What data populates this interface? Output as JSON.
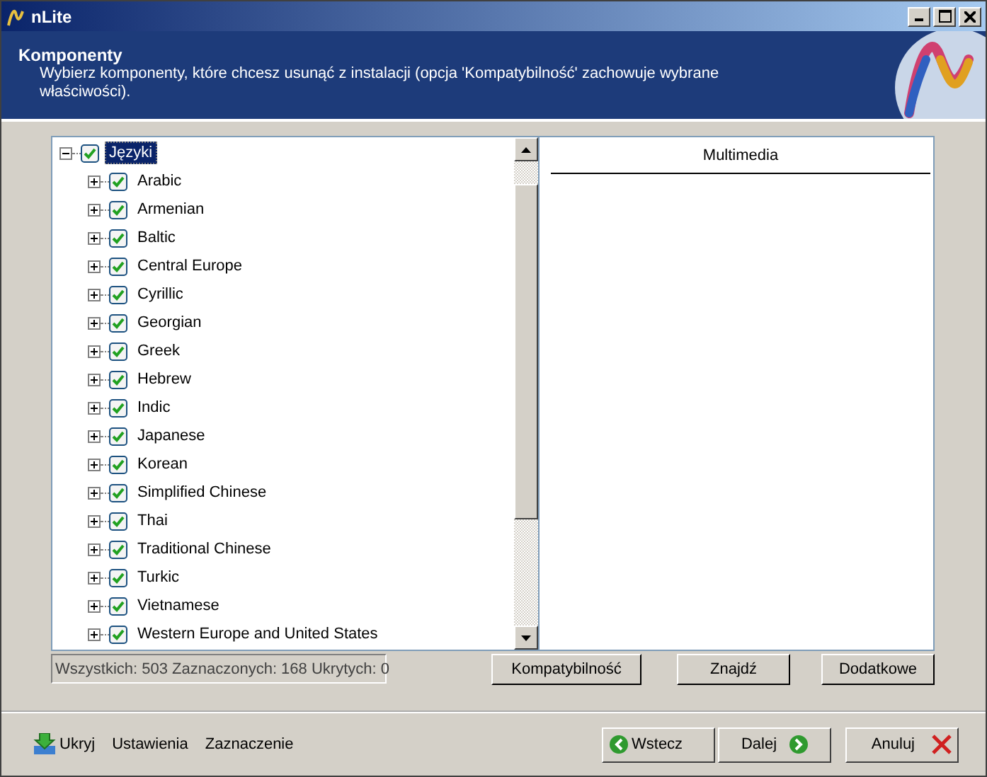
{
  "window": {
    "title": "nLite"
  },
  "header": {
    "title": "Komponenty",
    "description": "Wybierz komponenty, które chcesz usunąć z instalacji (opcja 'Kompatybilność' zachowuje wybrane właściwości)."
  },
  "tree": [
    {
      "label": "Języki",
      "checked": true,
      "expanded": true,
      "selected": true,
      "children": [
        {
          "label": "Arabic",
          "checked": true,
          "expanded": false,
          "selected": false
        },
        {
          "label": "Armenian",
          "checked": true,
          "expanded": false,
          "selected": false
        },
        {
          "label": "Baltic",
          "checked": true,
          "expanded": false,
          "selected": false
        },
        {
          "label": "Central Europe",
          "checked": true,
          "expanded": false,
          "selected": false
        },
        {
          "label": "Cyrillic",
          "checked": true,
          "expanded": false,
          "selected": false
        },
        {
          "label": "Georgian",
          "checked": true,
          "expanded": false,
          "selected": false
        },
        {
          "label": "Greek",
          "checked": true,
          "expanded": false,
          "selected": false
        },
        {
          "label": "Hebrew",
          "checked": true,
          "expanded": false,
          "selected": false
        },
        {
          "label": "Indic",
          "checked": true,
          "expanded": false,
          "selected": false
        },
        {
          "label": "Japanese",
          "checked": true,
          "expanded": false,
          "selected": false
        },
        {
          "label": "Korean",
          "checked": true,
          "expanded": false,
          "selected": false
        },
        {
          "label": "Simplified Chinese",
          "checked": true,
          "expanded": false,
          "selected": false
        },
        {
          "label": "Thai",
          "checked": true,
          "expanded": false,
          "selected": false
        },
        {
          "label": "Traditional Chinese",
          "checked": true,
          "expanded": false,
          "selected": false
        },
        {
          "label": "Turkic",
          "checked": true,
          "expanded": false,
          "selected": false
        },
        {
          "label": "Vietnamese",
          "checked": true,
          "expanded": false,
          "selected": false
        },
        {
          "label": "Western Europe and United States",
          "checked": true,
          "expanded": false,
          "selected": false
        }
      ]
    }
  ],
  "details": {
    "heading": "Multimedia"
  },
  "status": "Wszystkich: 503 Zaznaczonych: 168 Ukrytych: 0",
  "panel_buttons": [
    "Kompatybilność",
    "Znajdź",
    "Dodatkowe"
  ],
  "footer_links": [
    {
      "label": "Ukryj",
      "kind": "icon"
    },
    {
      "label": "Ustawienia",
      "kind": "plain"
    },
    {
      "label": "Zaznaczenie",
      "kind": "plain"
    }
  ],
  "nav_buttons": [
    {
      "label": "Wstecz",
      "kind": "back"
    },
    {
      "label": "Dalej",
      "kind": "next"
    },
    {
      "label": "Anuluj",
      "kind": "cancel"
    }
  ]
}
